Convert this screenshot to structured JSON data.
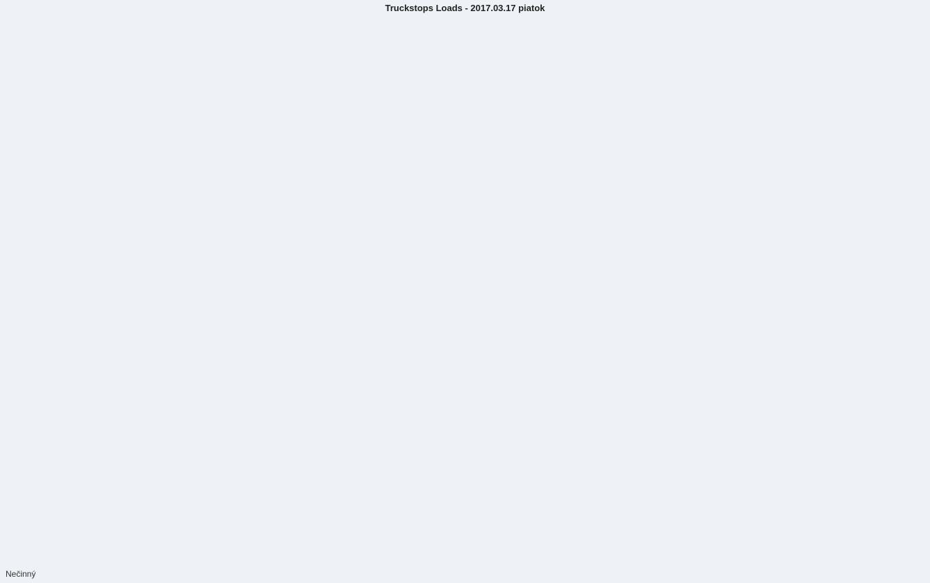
{
  "window": {
    "title": "Truckstops Loads - 2017.03.17 piatok"
  },
  "status": {
    "text": "Nečinný"
  }
}
